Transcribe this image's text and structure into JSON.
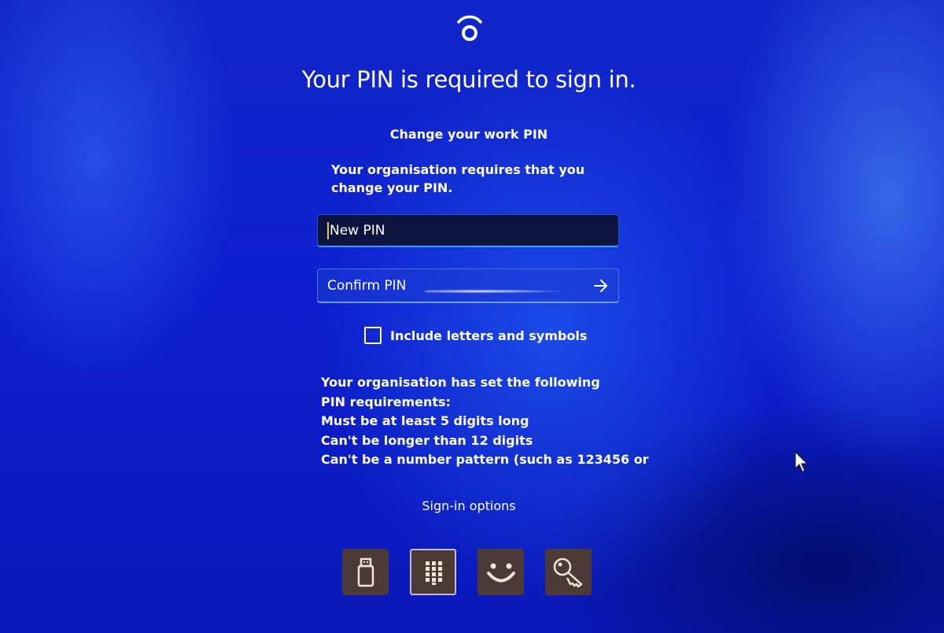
{
  "header": {
    "icon": "presence-sensor-icon",
    "title": "Your PIN is required to sign in."
  },
  "dialog": {
    "subtitle": "Change your work PIN",
    "description": "Your organisation requires that you change your PIN.",
    "new_pin": {
      "placeholder": "New PIN",
      "value": ""
    },
    "confirm_pin": {
      "placeholder": "Confirm PIN",
      "value": "",
      "submit_icon": "arrow-right-icon"
    },
    "include_letters": {
      "label": "Include letters and symbols",
      "checked": false
    },
    "requirements": [
      "Your organisation has set the following PIN requirements:",
      "Must be at least 5 digits long",
      "Can't be longer than 12 digits",
      "Can't be a number pattern (such as 123456 or"
    ]
  },
  "sign_in_options": {
    "label": "Sign-in options",
    "items": [
      {
        "name": "Security key",
        "icon": "usb-key-icon",
        "selected": false
      },
      {
        "name": "PIN",
        "icon": "keypad-icon",
        "selected": true
      },
      {
        "name": "Facial recognition",
        "icon": "smiley-face-icon",
        "selected": false
      },
      {
        "name": "Password",
        "icon": "key-icon",
        "selected": false
      }
    ]
  },
  "colors": {
    "background": "#0d1fd0",
    "option_tile": "#4b3a35",
    "field_dark": "#0e1440",
    "accent": "#3aa0ff"
  }
}
